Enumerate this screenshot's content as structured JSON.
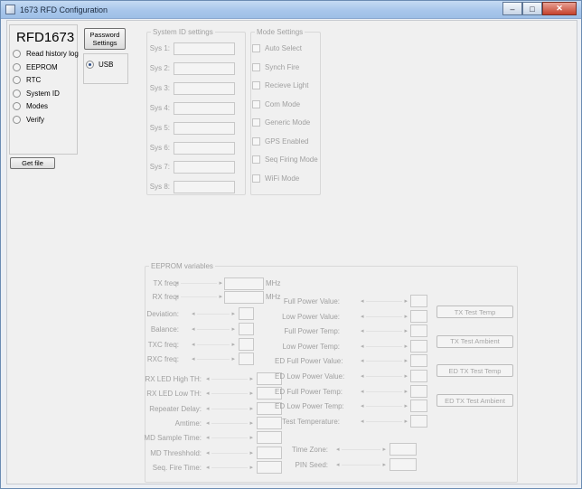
{
  "window": {
    "title": "1673 RFD Configuration",
    "min": "–",
    "max": "□",
    "close": "✕"
  },
  "app": {
    "name": "RFD1673"
  },
  "left_options": [
    "Read history log",
    "EEPROM",
    "RTC",
    "System ID",
    "Modes",
    "Verify"
  ],
  "password_button": "Password\nSettings",
  "connection": {
    "label": "USB"
  },
  "get_file_button": "Get file",
  "system_id": {
    "legend": "System ID settings",
    "labels": [
      "Sys 1:",
      "Sys 2:",
      "Sys 3:",
      "Sys 4:",
      "Sys 5:",
      "Sys 6:",
      "Sys 7:",
      "Sys 8:"
    ]
  },
  "modes": {
    "legend": "Mode Settings",
    "items": [
      "Auto Select",
      "Synch Fire",
      "Recieve Light",
      "Com Mode",
      "Generic Mode",
      "GPS Enabled",
      "Seq Firing Mode",
      "WiFi Mode"
    ]
  },
  "eeprom": {
    "legend": "EEPROM variables",
    "col1": [
      {
        "label": "TX freq:",
        "unit": "MHz"
      },
      {
        "label": "RX freq:",
        "unit": "MHz"
      },
      {
        "label": "Deviation:"
      },
      {
        "label": "Balance:"
      },
      {
        "label": "TXC freq:"
      },
      {
        "label": "RXC freq:"
      }
    ],
    "col2": [
      "RX LED High TH:",
      "RX LED Low TH:",
      "Repeater Delay:",
      "Amtime:",
      "MD Sample Time:",
      "MD Threshhold:",
      "Seq. Fire Time:"
    ],
    "col3": [
      "Full Power Value:",
      "Low Power Value:",
      "Full Power Temp:",
      "Low Power Temp:",
      "ED Full Power Value:",
      "ED Low Power Value:",
      "ED Full Power Temp:",
      "ED Low Power Temp:",
      "Test Temperature:"
    ],
    "col4": [
      "Time Zone:",
      "PIN Seed:"
    ],
    "buttons": [
      "TX Test Temp",
      "TX Test Ambient",
      "ED TX Test Temp",
      "ED TX Test Ambient"
    ]
  },
  "icons": {
    "scroll_left": "◂",
    "scroll_right": "▸"
  }
}
